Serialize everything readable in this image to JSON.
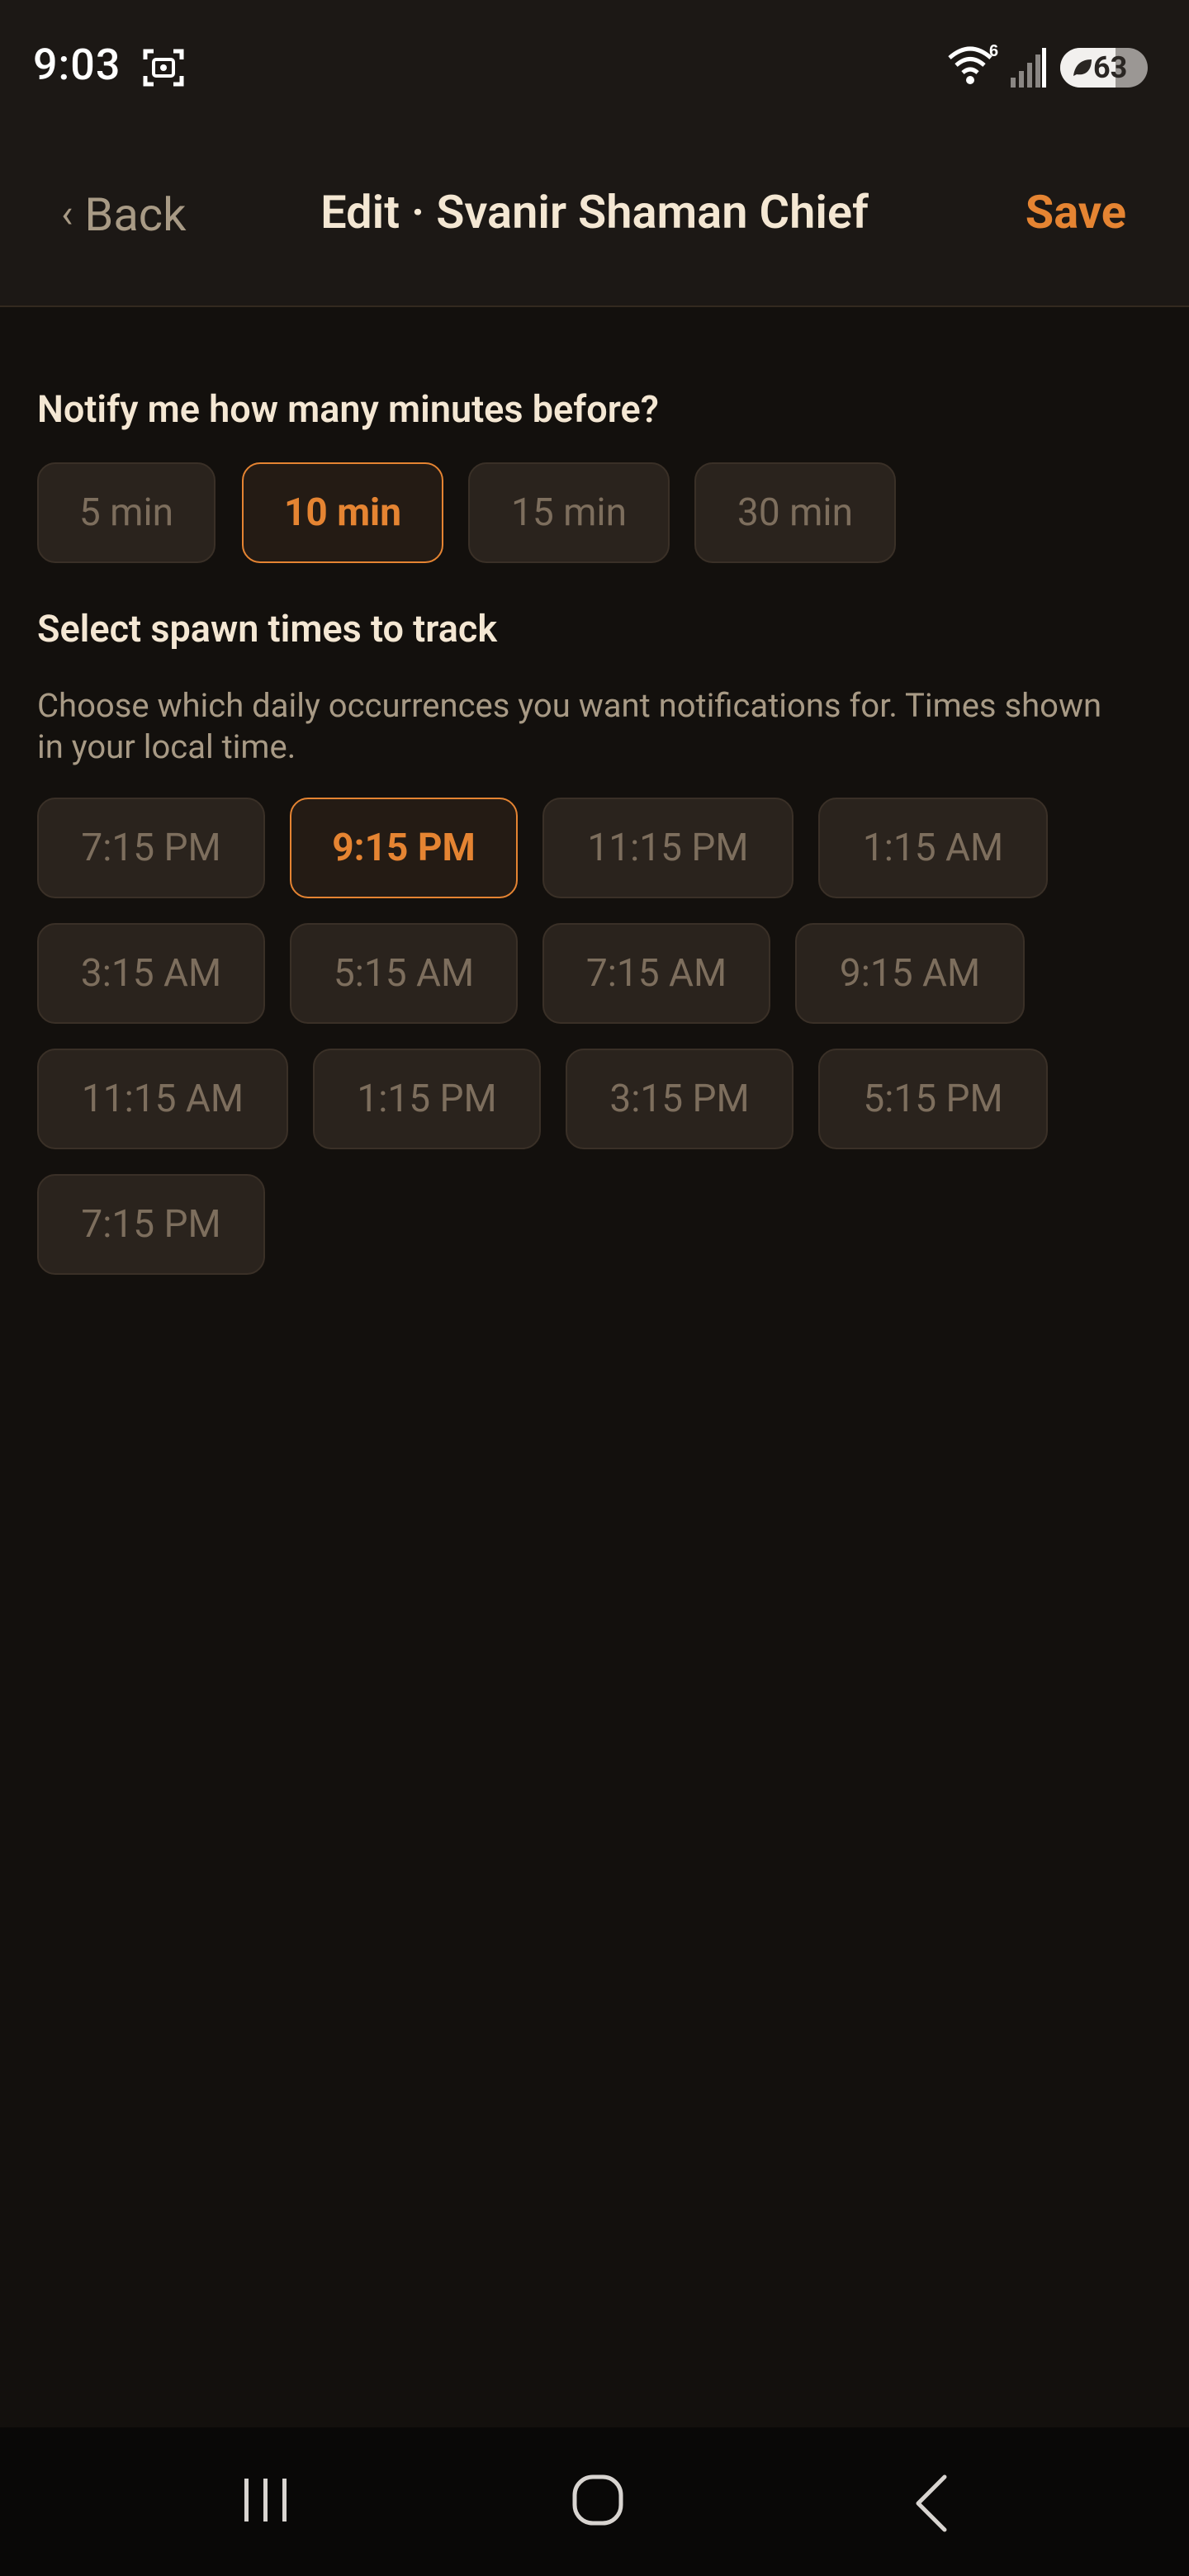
{
  "status_bar": {
    "time": "9:03",
    "wifi_badge": "6",
    "battery_percent": "63",
    "icons": [
      "screenshot-icon",
      "wifi-icon",
      "signal-icon",
      "battery-saver-icon"
    ]
  },
  "header": {
    "back_label": "Back",
    "title": "Edit · Svanir Shaman Chief",
    "save_label": "Save"
  },
  "notify": {
    "heading": "Notify me how many minutes before?",
    "options": [
      "5 min",
      "10 min",
      "15 min",
      "30 min"
    ],
    "selected": "10 min"
  },
  "spawn": {
    "heading": "Select spawn times to track",
    "description": "Choose which daily occurrences you want notifications for. Times shown in your local time.",
    "times": [
      "7:15 PM",
      "9:15 PM",
      "11:15 PM",
      "1:15 AM",
      "3:15 AM",
      "5:15 AM",
      "7:15 AM",
      "9:15 AM",
      "11:15 AM",
      "1:15 PM",
      "3:15 PM",
      "5:15 PM",
      "7:15 PM"
    ],
    "selected_index": 1
  },
  "colors": {
    "background": "#13100d",
    "accent": "#e58432",
    "chip_bg": "#2a231d",
    "heading_text": "#f4e7d3",
    "muted_text": "#a89a85"
  },
  "nav_bar": {
    "icons": [
      "recents-icon",
      "home-icon",
      "back-icon"
    ]
  }
}
